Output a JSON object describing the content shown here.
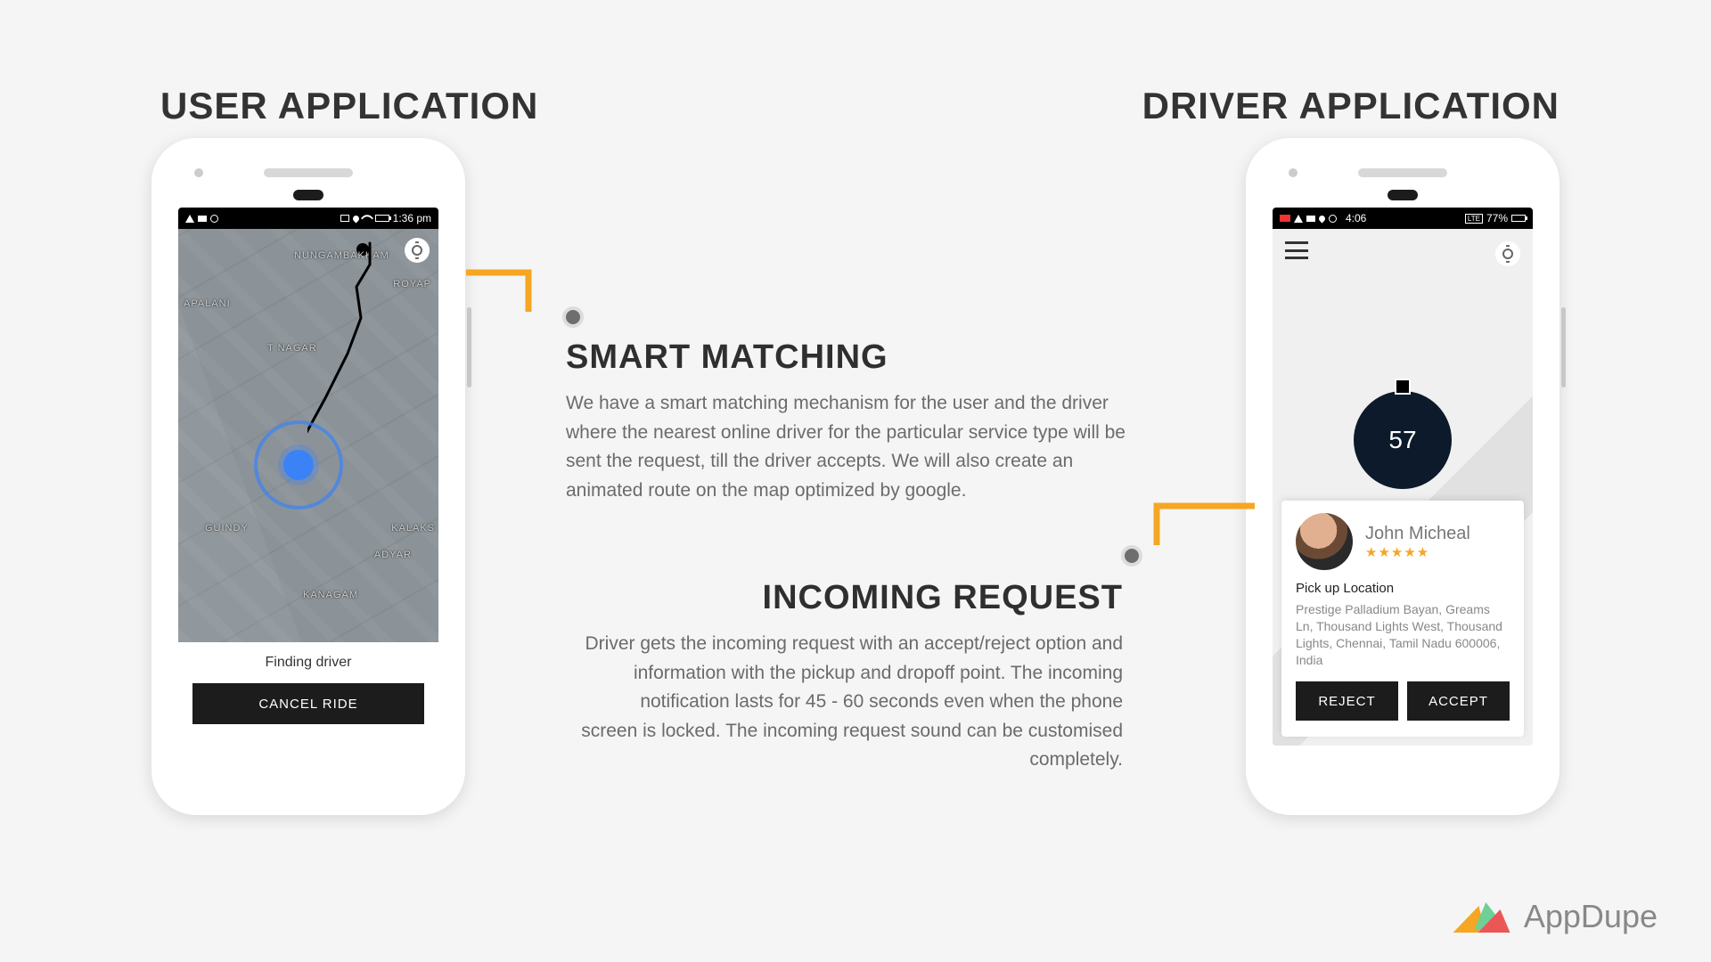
{
  "headings": {
    "user_app": "USER APPLICATION",
    "driver_app": "DRIVER APPLICATION"
  },
  "user_screen": {
    "status_time": "1:36 pm",
    "map_labels": {
      "nungambakkam": "NUNGAMBAKKAM",
      "kodambakkam": "APALANI",
      "tnagar": "T NAGAR",
      "guindy": "GUINDY",
      "adyar": "ADYAR",
      "kanagam": "KANAGAM",
      "royap": "ROYAP",
      "kalaks": "KALAKS"
    },
    "finding_text": "Finding driver",
    "cancel_label": "CANCEL RIDE"
  },
  "driver_screen": {
    "status_time": "4:06",
    "status_battery": "77%",
    "countdown": "57",
    "passenger_name": "John Micheal",
    "rating_stars": "★★★★★",
    "pickup_label": "Pick up Location",
    "pickup_address": "Prestige Palladium Bayan, Greams Ln, Thousand Lights West, Thousand Lights, Chennai, Tamil Nadu 600006, India",
    "reject_label": "REJECT",
    "accept_label": "ACCEPT"
  },
  "sections": {
    "smart_matching_title": "SMART MATCHING",
    "smart_matching_body": "We have a smart matching mechanism for the user and the driver where the nearest online driver for the particular service type will be sent the request, till the driver accepts. We will also create an animated route on the map optimized by google.",
    "incoming_request_title": "INCOMING REQUEST",
    "incoming_request_body": "Driver gets the incoming request with an accept/reject option and information with the pickup and dropoff point. The incoming notification lasts for 45 - 60 seconds even when the phone screen is locked. The incoming request sound can be customised completely."
  },
  "brand_name": "AppDupe"
}
